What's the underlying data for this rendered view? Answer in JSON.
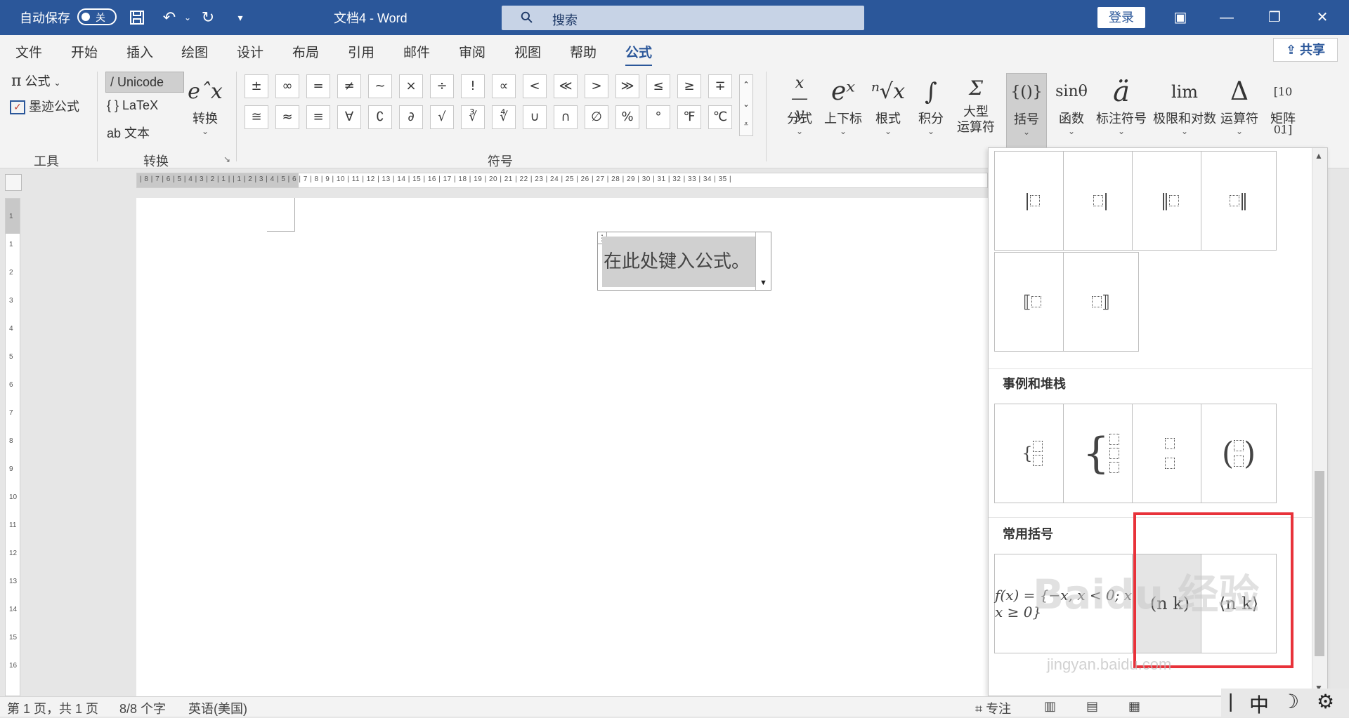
{
  "titlebar": {
    "autosave_label": "自动保存",
    "autosave_state": "关",
    "doc_title": "文档4  -  Word",
    "search_placeholder": "搜索",
    "login_label": "登录"
  },
  "menu": {
    "tabs": [
      "文件",
      "开始",
      "插入",
      "绘图",
      "设计",
      "布局",
      "引用",
      "邮件",
      "审阅",
      "视图",
      "帮助",
      "公式"
    ],
    "active_tab": "公式",
    "share_label": "共享"
  },
  "ribbon": {
    "tools": {
      "formula_label": "公式",
      "ink_formula_label": "墨迹公式",
      "group_label": "工具"
    },
    "convert": {
      "unicode_label": "Unicode",
      "latex_label": "LaTeX",
      "text_label": "文本",
      "convert_label": "转换",
      "group_label": "转换"
    },
    "symbols": {
      "group_label": "符号",
      "row1": [
        "±",
        "∞",
        "=",
        "≠",
        "~",
        "×",
        "÷",
        "!",
        "∝",
        "<",
        "≪",
        ">",
        "≫",
        "≤",
        "≥",
        "∓"
      ],
      "row2": [
        "≅",
        "≈",
        "≡",
        "∀",
        "∁",
        "∂",
        "√",
        "∛",
        "∜",
        "∪",
        "∩",
        "∅",
        "%",
        "°",
        "℉",
        "℃"
      ]
    },
    "structures": [
      {
        "glyph": "x/y",
        "label": "分式"
      },
      {
        "glyph": "eˣ",
        "label": "上下标"
      },
      {
        "glyph": "ⁿ√x",
        "label": "根式"
      },
      {
        "glyph": "∫",
        "label": "积分"
      },
      {
        "glyph": "Σ",
        "label": "大型\n运算符"
      },
      {
        "glyph": "{()}",
        "label": "括号"
      },
      {
        "glyph": "sinθ",
        "label": "函数"
      },
      {
        "glyph": "ä",
        "label": "标注符号"
      },
      {
        "glyph": "lim",
        "label": "极限和对数"
      },
      {
        "glyph": "Δ",
        "label": "运算符"
      },
      {
        "glyph": "[10 01]",
        "label": "矩阵"
      }
    ]
  },
  "ruler": {
    "ticks": "| 8 | 7 | 6 | 5 | 4 | 3 | 2 | 1 |    | 1 | 2 | 3 | 4 | 5 | 6 | 7 | 8 | 9 | 10 | 11 | 12 | 13 | 14 | 15 | 16 | 17 | 18 | 19 | 20 | 21 | 22 | 23 | 24 | 25 | 26 | 27 | 28 | 29 | 30 | 31 | 32 | 33 | 34 | 35 |"
  },
  "document": {
    "equation_placeholder": "在此处键入公式。"
  },
  "gallery": {
    "section_cases": "事例和堆栈",
    "section_common": "常用括号",
    "function_example": "f(x) = {−x, x < 0; x, x ≥ 0}",
    "binomial_paren": "(n k)",
    "binomial_angle": "⟨n k⟩",
    "watermark": "Baidu 经验",
    "watermark_url": "jingyan.baidu.com"
  },
  "statusbar": {
    "page": "第 1 页，共 1 页",
    "words": "8/8 个字",
    "language": "英语(美国)",
    "focus": "专注",
    "ime_char": "中"
  },
  "colors": {
    "brand": "#2b579a",
    "highlight": "#e8323a"
  }
}
